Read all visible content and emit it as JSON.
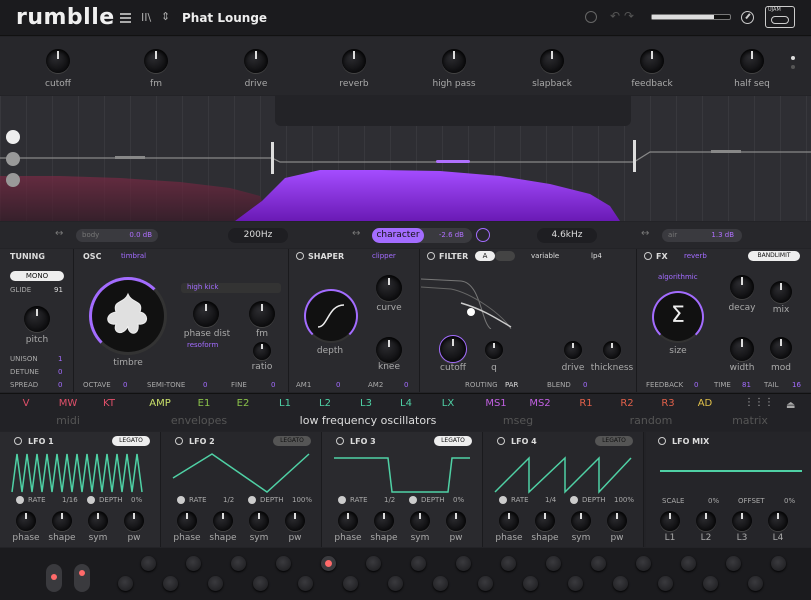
{
  "header": {
    "logo": "rumblle",
    "preset": "Phat Lounge",
    "menu_icon": "hamburger-icon",
    "browse_icon": "library-icon",
    "arrows_icon": "up-down-icon",
    "power_icon": "power-icon",
    "undo_icon": "undo-icon",
    "redo_icon": "redo-icon",
    "gauge_icon": "gauge-icon",
    "brand": "UJAM"
  },
  "macros": [
    "cutoff",
    "fm",
    "drive",
    "reverb",
    "high pass",
    "slapback",
    "feedback",
    "half seq"
  ],
  "eq": {
    "body_label": "body",
    "body_value": "0.0 dB",
    "low_freq": "200Hz",
    "character_label": "character",
    "character_value": "-2.6 dB",
    "high_freq": "4.6kHz",
    "air_label": "air",
    "air_value": "1.3 dB"
  },
  "tuning": {
    "title": "TUNING",
    "mono": "MONO",
    "glide_label": "GLIDE",
    "glide_value": "91",
    "pitch": "pitch",
    "unison_label": "UNISON",
    "unison_value": "1",
    "detune_label": "DETUNE",
    "detune_value": "0",
    "spread_label": "SPREAD",
    "spread_value": "0"
  },
  "osc": {
    "title": "OSC",
    "type": "timbral",
    "preset": "high kick",
    "mode": "resoform",
    "timbre": "timbre",
    "phase_dist": "phase dist",
    "fm": "fm",
    "ratio": "ratio",
    "octave_label": "OCTAVE",
    "octave_value": "0",
    "semitone_label": "SEMI-TONE",
    "semitone_value": "0",
    "fine_label": "FINE",
    "fine_value": "0"
  },
  "shaper": {
    "title": "SHAPER",
    "type": "clipper",
    "depth": "depth",
    "curve": "curve",
    "knee": "knee",
    "am1_label": "AM1",
    "am1_value": "0",
    "am2_label": "AM2",
    "am2_value": "0"
  },
  "filter": {
    "title": "FILTER",
    "slot": "A",
    "type": "variable",
    "mode": "lp4",
    "cutoff": "cutoff",
    "q": "q",
    "drive": "drive",
    "thickness": "thickness",
    "routing_label": "ROUTING",
    "routing_value": "PAR",
    "blend_label": "BLEND",
    "blend_value": "0"
  },
  "fx": {
    "title": "FX",
    "type": "reverb",
    "bandlimit": "BANDLIMIT",
    "algo": "algorithmic",
    "size": "size",
    "decay": "decay",
    "mix": "mix",
    "width": "width",
    "mod": "mod",
    "feedback_label": "FEEDBACK",
    "feedback_value": "0",
    "time_label": "TIME",
    "time_value": "81",
    "tail_label": "TAIL",
    "tail_value": "16"
  },
  "mod_tabs": [
    {
      "label": "V",
      "color": "#e0506a"
    },
    {
      "label": "MW",
      "color": "#e0506a"
    },
    {
      "label": "KT",
      "color": "#e0506a"
    },
    {
      "label": "AMP",
      "color": "#c9e06a"
    },
    {
      "label": "E1",
      "color": "#8bc34a"
    },
    {
      "label": "E2",
      "color": "#8bc34a"
    },
    {
      "label": "L1",
      "color": "#4fd1a5"
    },
    {
      "label": "L2",
      "color": "#4fd1a5"
    },
    {
      "label": "L3",
      "color": "#4fd1a5"
    },
    {
      "label": "L4",
      "color": "#4fd1a5"
    },
    {
      "label": "LX",
      "color": "#4fd1a5"
    },
    {
      "label": "MS1",
      "color": "#c060e0"
    },
    {
      "label": "MS2",
      "color": "#c060e0"
    },
    {
      "label": "R1",
      "color": "#e0604a"
    },
    {
      "label": "R2",
      "color": "#e0604a"
    },
    {
      "label": "R3",
      "color": "#e0604a"
    },
    {
      "label": "AD",
      "color": "#e0c04a"
    }
  ],
  "mod_groups": [
    "midi",
    "envelopes",
    "low frequency oscillators",
    "mseg",
    "random",
    "matrix"
  ],
  "lfos": [
    {
      "title": "LFO 1",
      "legato": "LEGATO",
      "rate_label": "RATE",
      "rate_value": "1/16",
      "depth_label": "DEPTH",
      "depth_value": "0%",
      "knobs": [
        "phase",
        "shape",
        "sym",
        "pw"
      ]
    },
    {
      "title": "LFO 2",
      "legato": "LEGATO",
      "rate_label": "RATE",
      "rate_value": "1/2",
      "depth_label": "DEPTH",
      "depth_value": "100%",
      "knobs": [
        "phase",
        "shape",
        "sym",
        "pw"
      ]
    },
    {
      "title": "LFO 3",
      "legato": "LEGATO",
      "rate_label": "RATE",
      "rate_value": "1/2",
      "depth_label": "DEPTH",
      "depth_value": "0%",
      "knobs": [
        "phase",
        "shape",
        "sym",
        "pw"
      ]
    },
    {
      "title": "LFO 4",
      "legato": "LEGATO",
      "rate_label": "RATE",
      "rate_value": "1/4",
      "depth_label": "DEPTH",
      "depth_value": "100%",
      "knobs": [
        "phase",
        "shape",
        "sym",
        "pw"
      ]
    }
  ],
  "lfomix": {
    "title": "LFO MIX",
    "scale_label": "SCALE",
    "scale_value": "0%",
    "offset_label": "OFFSET",
    "offset_value": "0%",
    "knobs": [
      "L1",
      "L2",
      "L3",
      "L4"
    ]
  },
  "colors": {
    "accent": "#a36cff",
    "lfo": "#4fd1a5",
    "background": "#232327"
  }
}
